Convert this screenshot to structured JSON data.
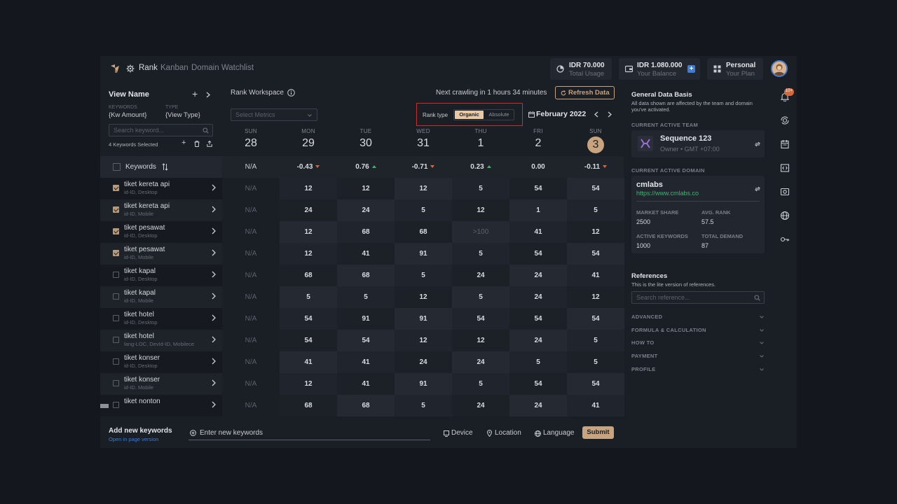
{
  "nav": {
    "rank": "Rank",
    "kanban": "Kanban",
    "watchlist": "Domain Watchlist"
  },
  "stats": [
    {
      "value": "IDR 70.000",
      "label": "Total Usage",
      "icon": "pie-chart-icon"
    },
    {
      "value": "IDR 1.080.000",
      "label": "Your Balance",
      "icon": "wallet-icon"
    },
    {
      "value": "Personal",
      "label": "Your Plan",
      "icon": "grid-icon"
    }
  ],
  "left": {
    "view_name": "View Name",
    "keywords_label": "KEYWORDS",
    "keywords_value": "{Kw Amount}",
    "type_label": "TYPE",
    "type_value": "{View Type}",
    "search_placeholder": "Search keyword...",
    "selected": "4 Keywords Selected",
    "col_header": "Keywords"
  },
  "workspace": {
    "title": "Rank Workspace",
    "next_crawl": "Next crawling in 1 hours 34 minutes",
    "refresh": "Refresh Data",
    "metrics_placeholder": "Select Metrics",
    "rank_type_label": "Rank type",
    "rank_type_options": [
      "Organic",
      "Absolute"
    ],
    "month": "February 2022"
  },
  "days": [
    {
      "name": "SUN",
      "date": "28",
      "delta": "N/A",
      "trend": "none"
    },
    {
      "name": "MON",
      "date": "29",
      "delta": "-0.43",
      "trend": "down"
    },
    {
      "name": "TUE",
      "date": "30",
      "delta": "0.76",
      "trend": "up"
    },
    {
      "name": "WED",
      "date": "31",
      "delta": "-0.71",
      "trend": "down"
    },
    {
      "name": "THU",
      "date": "1",
      "delta": "0.23",
      "trend": "up"
    },
    {
      "name": "FRI",
      "date": "2",
      "delta": "0.00",
      "trend": "none"
    },
    {
      "name": "SUN",
      "date": "3",
      "delta": "-0.11",
      "trend": "down",
      "today": true
    }
  ],
  "keywords": [
    {
      "name": "tiket kereta api",
      "sub": "id-ID, Desktop",
      "checked": true,
      "values": [
        "N/A",
        "12",
        "12",
        "12",
        "5",
        "54",
        "54"
      ]
    },
    {
      "name": "tiket kereta api",
      "sub": "id-ID, Mobile",
      "checked": true,
      "values": [
        "N/A",
        "24",
        "24",
        "5",
        "12",
        "1",
        "5"
      ]
    },
    {
      "name": "tiket pesawat",
      "sub": "id-ID, Desktop",
      "checked": true,
      "values": [
        "N/A",
        "12",
        "68",
        "68",
        ">100",
        "41",
        "12"
      ]
    },
    {
      "name": "tiket pesawat",
      "sub": "id-ID, Mobile",
      "checked": true,
      "values": [
        "N/A",
        "12",
        "41",
        "91",
        "5",
        "54",
        "54"
      ]
    },
    {
      "name": "tiket kapal",
      "sub": "id-ID, Desktop",
      "checked": false,
      "values": [
        "N/A",
        "68",
        "68",
        "5",
        "24",
        "24",
        "41"
      ]
    },
    {
      "name": "tiket kapal",
      "sub": "id-ID, Mobile",
      "checked": false,
      "values": [
        "N/A",
        "5",
        "5",
        "12",
        "5",
        "24",
        "12"
      ]
    },
    {
      "name": "tiket hotel",
      "sub": "id-ID, Desktop",
      "checked": false,
      "values": [
        "N/A",
        "54",
        "91",
        "91",
        "54",
        "54",
        "54"
      ]
    },
    {
      "name": "tiket hotel",
      "sub": "lang-LOC, DevId-ID, Mobilece",
      "checked": false,
      "values": [
        "N/A",
        "54",
        "54",
        "12",
        "12",
        "24",
        "5"
      ]
    },
    {
      "name": "tiket konser",
      "sub": "id-ID, Desktop",
      "checked": false,
      "values": [
        "N/A",
        "41",
        "41",
        "24",
        "24",
        "5",
        "5"
      ]
    },
    {
      "name": "tiket konser",
      "sub": "id-ID, Mobile",
      "checked": false,
      "values": [
        "N/A",
        "12",
        "41",
        "91",
        "5",
        "54",
        "54"
      ]
    },
    {
      "name": "tiket nonton",
      "sub": "",
      "checked": false,
      "values": [
        "N/A",
        "68",
        "68",
        "5",
        "24",
        "24",
        "41"
      ]
    }
  ],
  "bottom": {
    "add_title": "Add new keywords",
    "open_link": "Open in page version",
    "input_placeholder": "Enter new keywords",
    "device": "Device",
    "location": "Location",
    "language": "Language",
    "submit": "Submit"
  },
  "right": {
    "gdb_title": "General Data Basis",
    "gdb_desc": "All data shown are affected by the team and domain you've activated.",
    "team_label": "CURRENT ACTIVE TEAM",
    "team_name": "Sequence 123",
    "team_sub": "Owner • GMT +07:00",
    "domain_label": "CURRENT ACTIVE DOMAIN",
    "domain_name": "cmlabs",
    "domain_url": "https://www.cmlabs.co",
    "market_share_label": "MARKET SHARE",
    "market_share": "2500",
    "avg_rank_label": "AVG. RANK",
    "avg_rank": "57.5",
    "active_kw_label": "ACTIVE KEYWORDS",
    "active_kw": "1000",
    "total_demand_label": "TOTAL DEMAND",
    "total_demand": "87",
    "ref_title": "References",
    "ref_desc": "This is the lite version of references.",
    "ref_placeholder": "Search reference...",
    "accordion": [
      "ADVANCED",
      "FORMULA & CALCULATION",
      "HOW TO",
      "PAYMENT",
      "PROFILE"
    ]
  },
  "notif_count": "10+",
  "colors": {
    "accent": "#c8a47e",
    "today": "#c8a47e",
    "link": "#3b7dd8",
    "up": "#3cb46e",
    "down": "#d2693e"
  }
}
